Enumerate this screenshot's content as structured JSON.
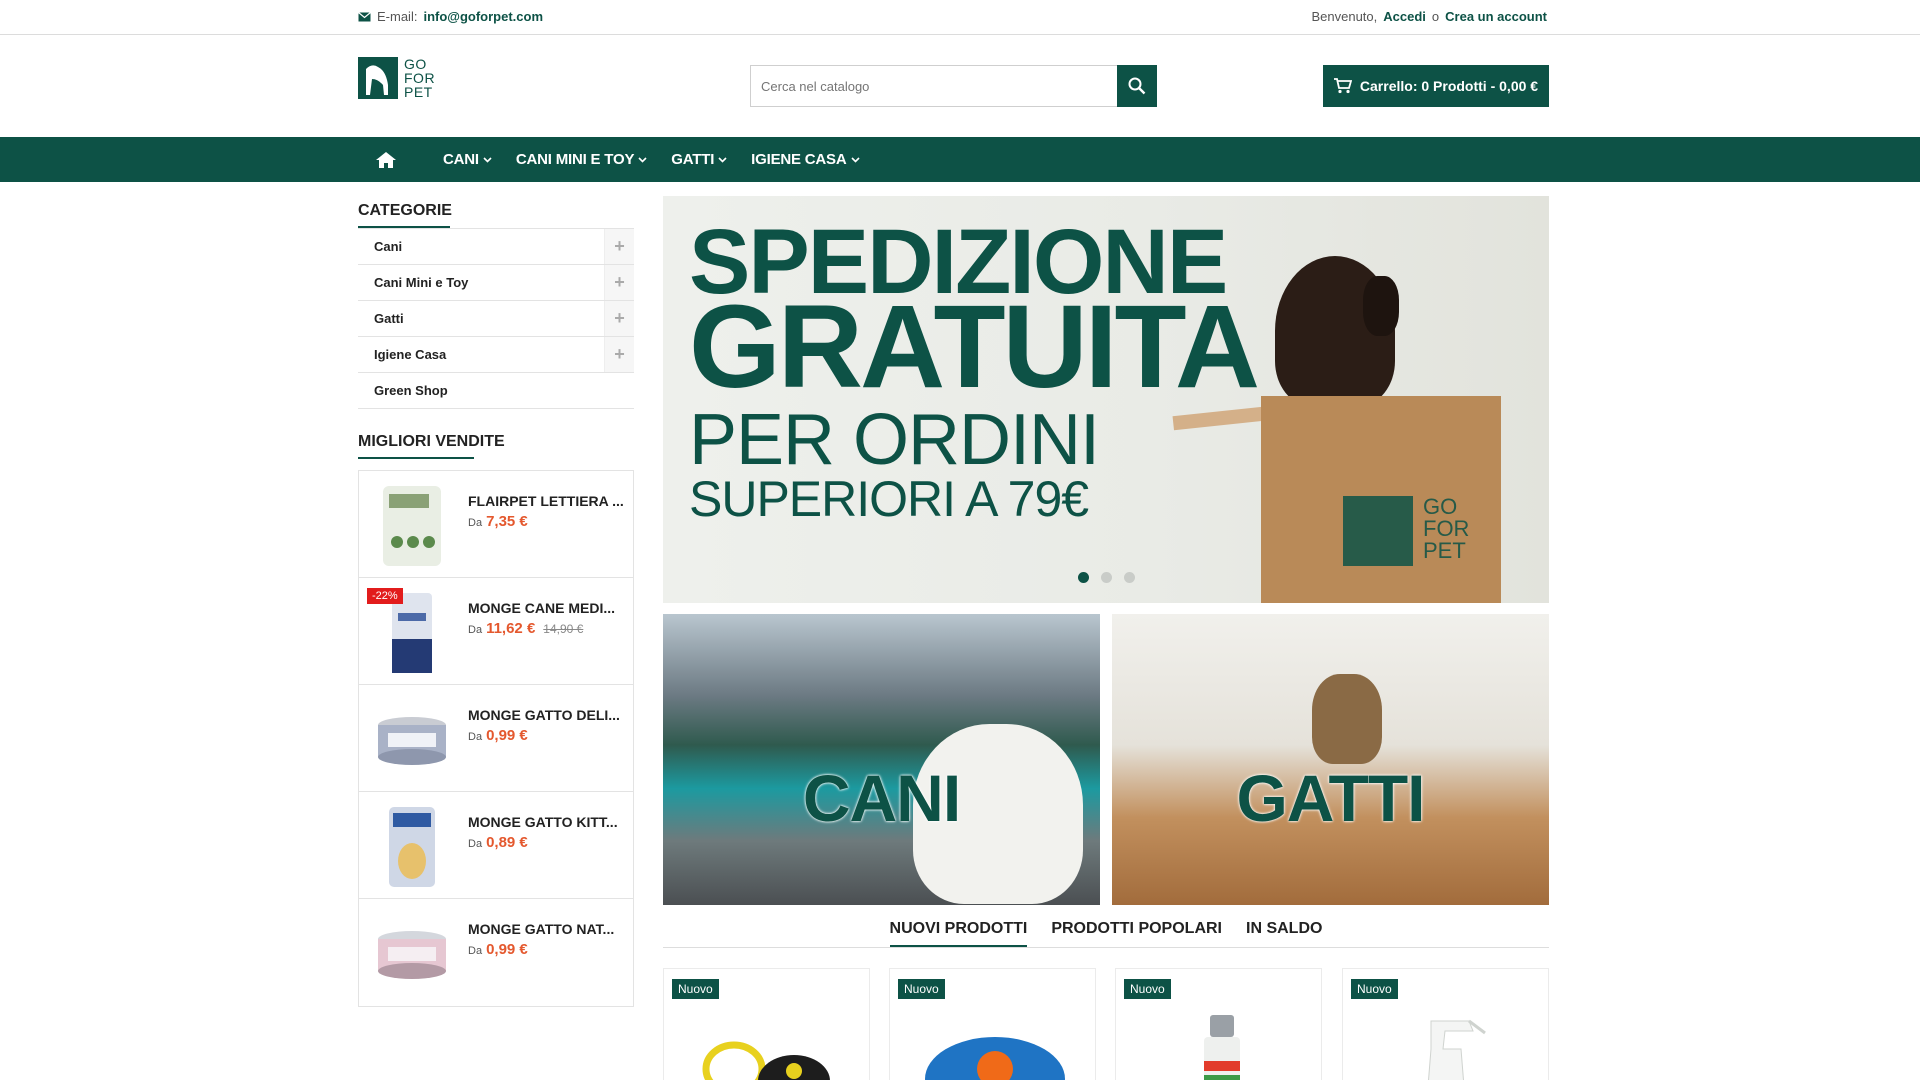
{
  "topbar": {
    "email_label": "E-mail:",
    "email": "info@goforpet.com",
    "welcome": "Benvenuto,",
    "login": "Accedi",
    "or": "o",
    "create_account": "Crea un account"
  },
  "header": {
    "logo_text": [
      "GO",
      "FOR",
      "PET"
    ],
    "search_placeholder": "Cerca nel catalogo",
    "cart_label": "Carrello: 0 Prodotti - 0,00 €"
  },
  "nav": {
    "items": [
      {
        "label": "CANI"
      },
      {
        "label": "CANI MINI E TOY"
      },
      {
        "label": "GATTI"
      },
      {
        "label": "IGIENE CASA"
      }
    ]
  },
  "sidebar": {
    "categories_title": "CATEGORIE",
    "categories": [
      {
        "label": "Cani",
        "expandable": true
      },
      {
        "label": "Cani Mini e Toy",
        "expandable": true
      },
      {
        "label": "Gatti",
        "expandable": true
      },
      {
        "label": "Igiene Casa",
        "expandable": true
      },
      {
        "label": "Green Shop",
        "expandable": false
      }
    ],
    "best_title": "MIGLIORI VENDITE",
    "best_sellers": [
      {
        "name": "FLAIRPET LETTIERA ...",
        "from": "Da",
        "price": "7,35 €",
        "old_price": "",
        "discount": ""
      },
      {
        "name": "MONGE CANE MEDI...",
        "from": "Da",
        "price": "11,62 €",
        "old_price": "14,90 €",
        "discount": "-22%"
      },
      {
        "name": "MONGE GATTO DELI...",
        "from": "Da",
        "price": "0,99 €",
        "old_price": "",
        "discount": ""
      },
      {
        "name": "MONGE GATTO KITT...",
        "from": "Da",
        "price": "0,89 €",
        "old_price": "",
        "discount": ""
      },
      {
        "name": "MONGE GATTO NAT...",
        "from": "Da",
        "price": "0,99 €",
        "old_price": "",
        "discount": ""
      }
    ]
  },
  "hero": {
    "line1": "SPEDIZIONE",
    "line2": "GRATUITA",
    "line3": "PER ORDINI",
    "line4": "SUPERIORI A 79€",
    "box_logo": [
      "GO",
      "FOR",
      "PET"
    ],
    "slides": 3,
    "active_slide": 1
  },
  "tiles": {
    "cani": "CANI",
    "gatti": "GATTI"
  },
  "products": {
    "tabs": [
      {
        "label": "NUOVI PRODOTTI",
        "active": true
      },
      {
        "label": "PRODOTTI POPOLARI",
        "active": false
      },
      {
        "label": "IN SALDO",
        "active": false
      }
    ],
    "cards": [
      {
        "badge": "Nuovo"
      },
      {
        "badge": "Nuovo"
      },
      {
        "badge": "Nuovo"
      },
      {
        "badge": "Nuovo"
      }
    ]
  },
  "colors": {
    "brand": "#0d5246",
    "price": "#e4582e",
    "discount": "#e21c1c"
  }
}
